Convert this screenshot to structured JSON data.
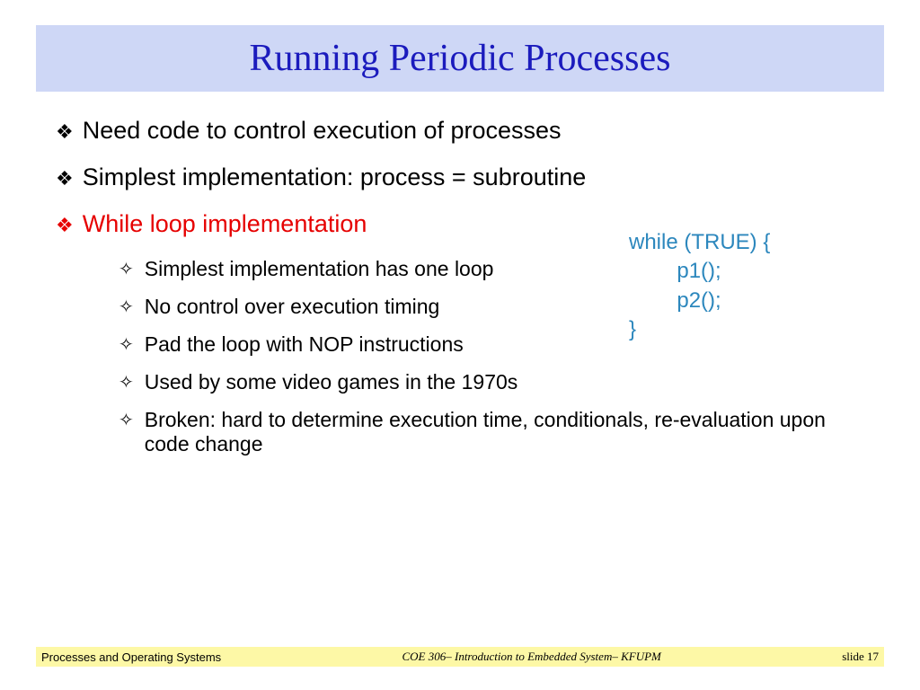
{
  "title": "Running Periodic Processes",
  "bullets": {
    "b1": "Need code to control execution of processes",
    "b2": "Simplest implementation: process = subroutine",
    "b3": "While loop implementation",
    "s1": "Simplest implementation has one loop",
    "s2": "No control over execution timing",
    "s3": "Pad the loop with NOP instructions",
    "s4": "Used by some video games in the 1970s",
    "s5": "Broken: hard to determine execution time, conditionals, re-evaluation upon code change"
  },
  "code": {
    "l1": "while (TRUE) {",
    "l2": "        p1();",
    "l3": "        p2();",
    "l4": "}"
  },
  "footer": {
    "left": "Processes and Operating Systems",
    "center": "COE 306– Introduction to Embedded System– KFUPM",
    "right": "slide 17"
  }
}
